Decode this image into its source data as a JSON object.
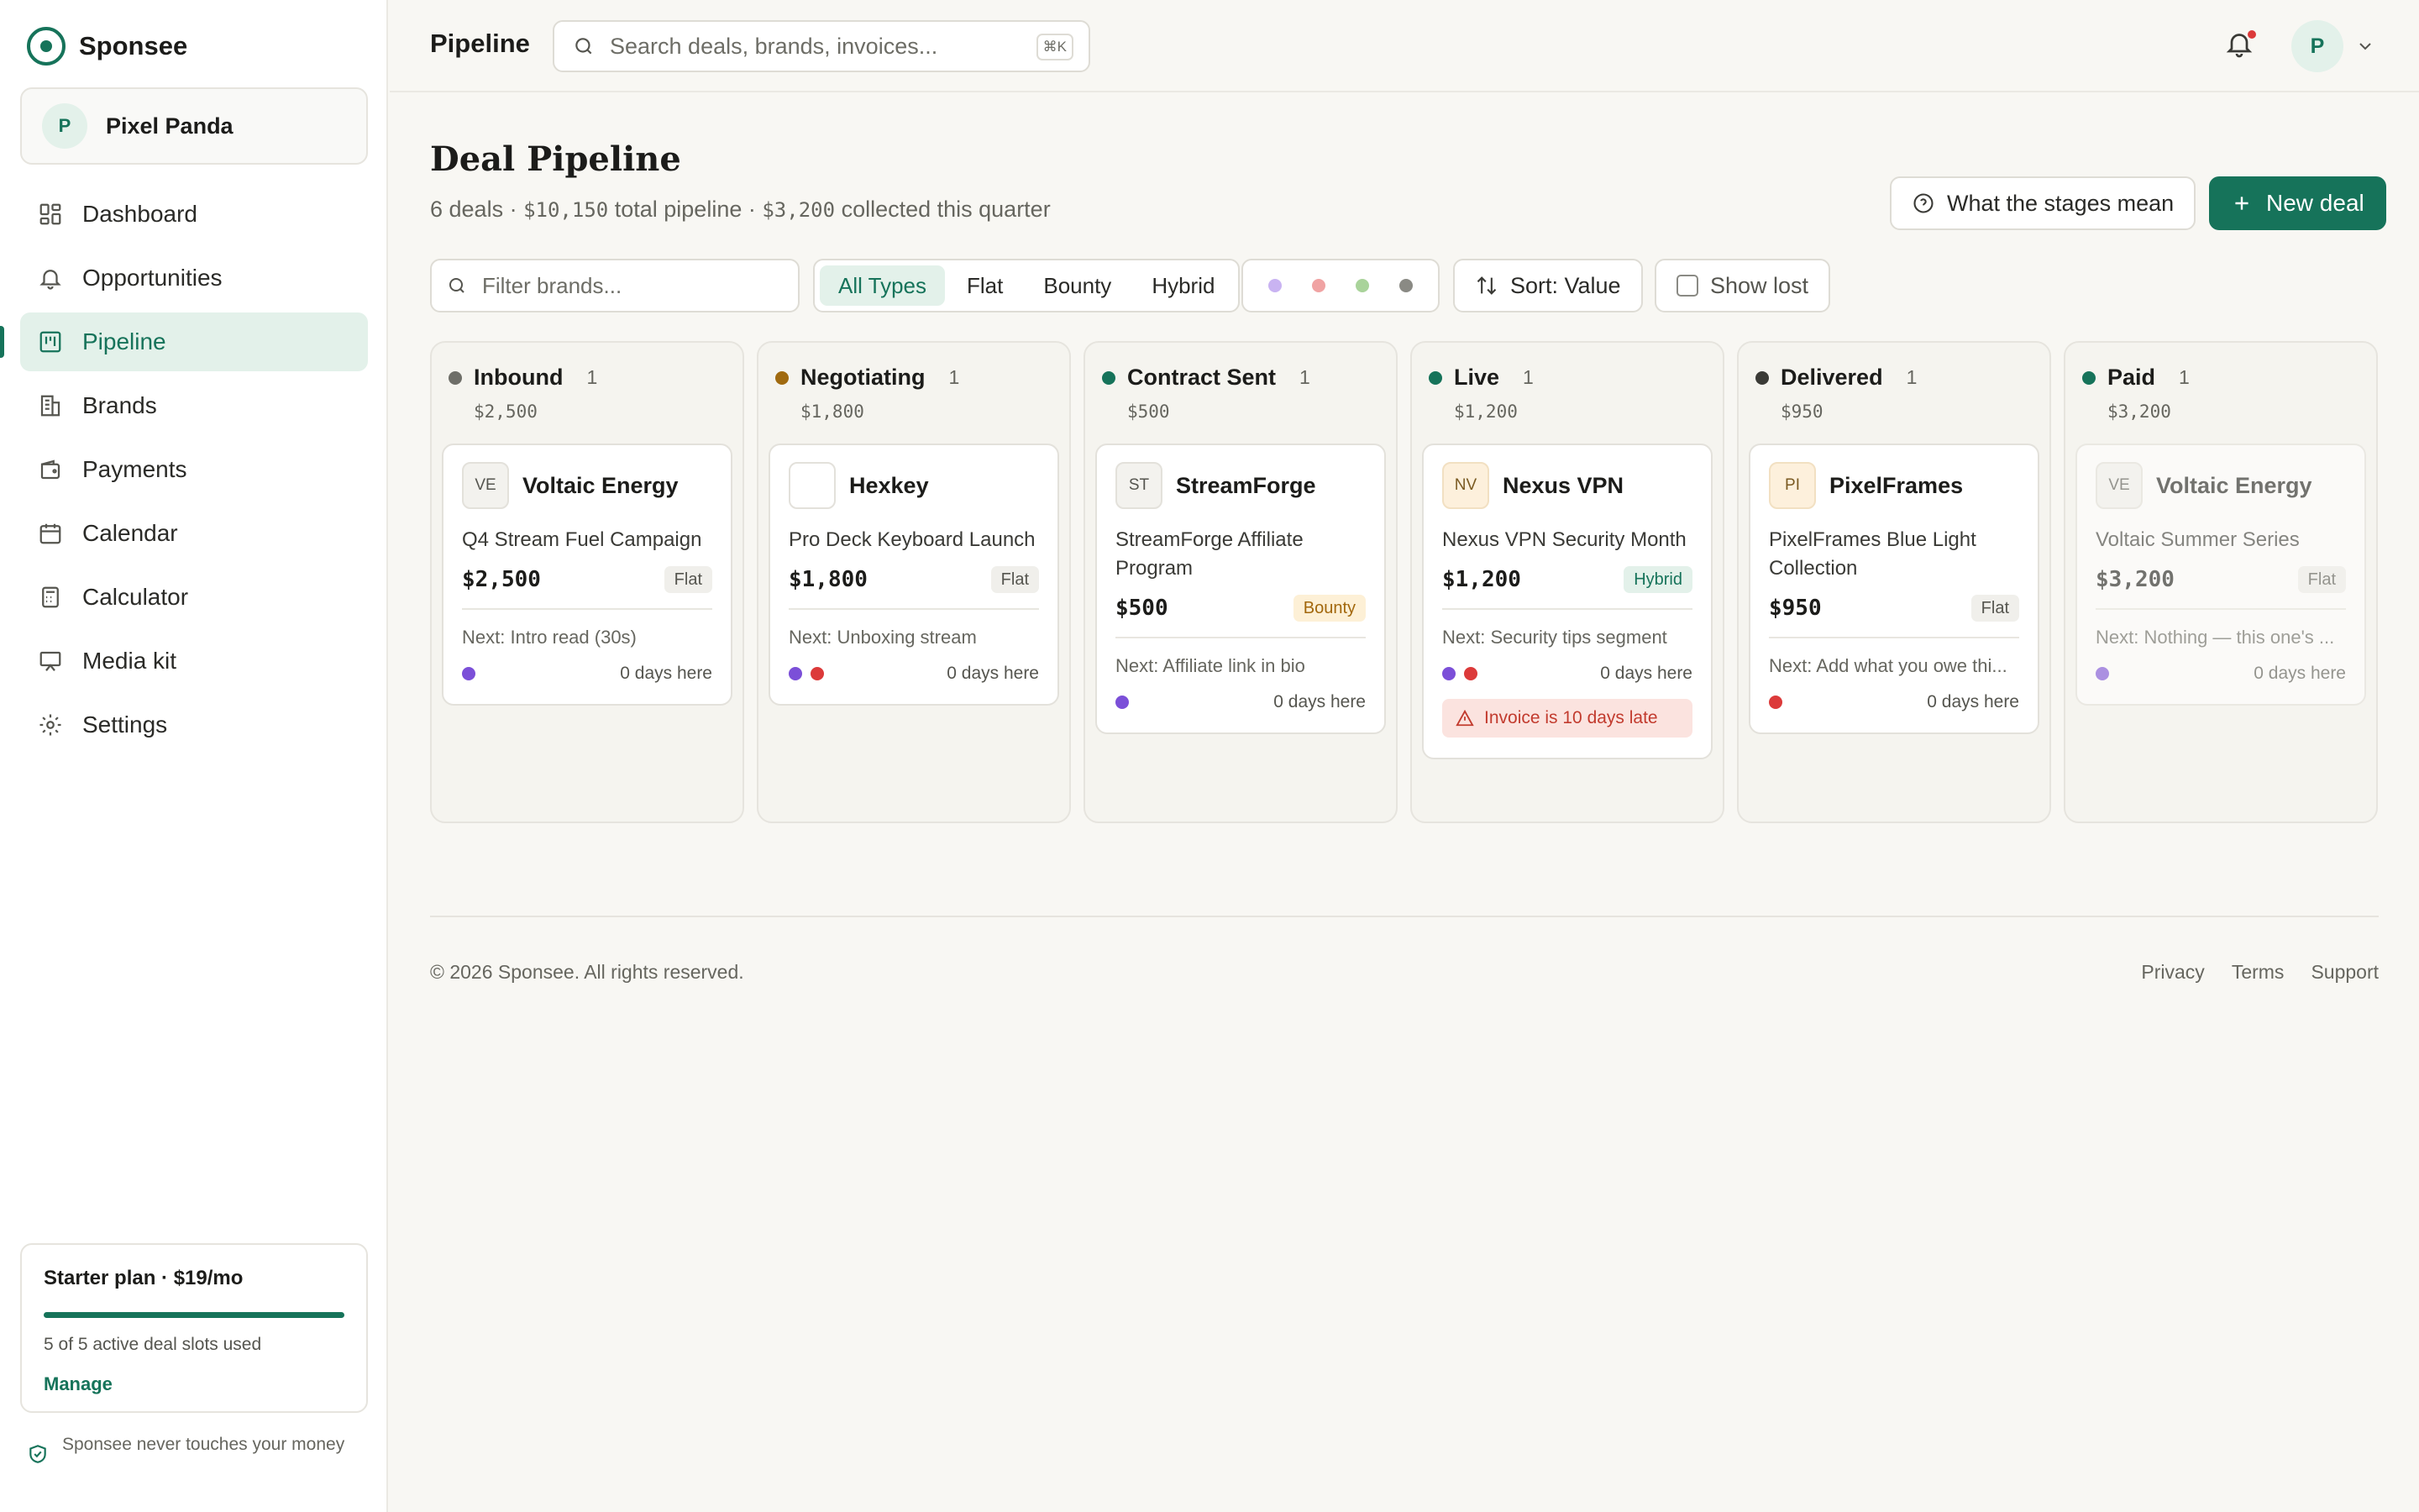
{
  "app": {
    "name": "Sponsee",
    "workspace": {
      "initial": "P",
      "name": "Pixel Panda"
    }
  },
  "sidebar": {
    "items": [
      {
        "label": "Dashboard",
        "icon": "dashboard-icon"
      },
      {
        "label": "Opportunities",
        "icon": "bell-icon"
      },
      {
        "label": "Pipeline",
        "icon": "pipeline-icon",
        "active": true
      },
      {
        "label": "Brands",
        "icon": "building-icon"
      },
      {
        "label": "Payments",
        "icon": "wallet-icon"
      },
      {
        "label": "Calendar",
        "icon": "calendar-icon"
      },
      {
        "label": "Calculator",
        "icon": "calculator-icon"
      },
      {
        "label": "Media kit",
        "icon": "presentation-icon"
      },
      {
        "label": "Settings",
        "icon": "gear-icon"
      }
    ],
    "plan": {
      "title": "Starter plan · $19/mo",
      "usage": "5 of 5 active deal slots used",
      "usage_fraction": 1.0,
      "manage": "Manage"
    },
    "trust_note": "Sponsee never touches your money"
  },
  "header": {
    "title": "Pipeline",
    "search_placeholder": "Search deals, brands, invoices...",
    "search_shortcut": "⌘K",
    "user_initial": "P"
  },
  "page": {
    "title": "Deal Pipeline",
    "summary": {
      "deals": "6 deals",
      "sep": " · ",
      "total_value": "$10,150",
      "total_label": " total pipeline",
      "collected_value": "$3,200",
      "collected_label": " collected this quarter"
    },
    "stages_button": "What the stages mean",
    "new_deal_button": "New deal"
  },
  "filters": {
    "brand_placeholder": "Filter brands...",
    "types": [
      "All Types",
      "Flat",
      "Bounty",
      "Hybrid"
    ],
    "active_type": "All Types",
    "color_dots": [
      "#c9b3f2",
      "#f0a3a3",
      "#a9d39a",
      "#8a8a84"
    ],
    "sort_label": "Sort: Value",
    "show_lost_label": "Show lost"
  },
  "columns": [
    {
      "name": "Inbound",
      "count": "1",
      "total": "$2,500",
      "color": "#6e6e68",
      "card": {
        "logo": "VE",
        "brand": "Voltaic Energy",
        "title": "Q4 Stream Fuel Campaign",
        "value": "$2,500",
        "type": "Flat",
        "next_label": "Next:",
        "next": "Intro read (30s)",
        "dots": [
          "#7b4fd8"
        ],
        "days": "0 days here"
      }
    },
    {
      "name": "Negotiating",
      "count": "1",
      "total": "$1,800",
      "color": "#a06a10",
      "card": {
        "logo": "",
        "brand": "Hexkey",
        "title": "Pro Deck Keyboard Launch",
        "value": "$1,800",
        "type": "Flat",
        "next_label": "Next:",
        "next": "Unboxing stream",
        "dots": [
          "#7b4fd8",
          "#dc3a3a"
        ],
        "days": "0 days here"
      }
    },
    {
      "name": "Contract Sent",
      "count": "1",
      "total": "$500",
      "color": "#16735a",
      "card": {
        "logo": "ST",
        "brand": "StreamForge",
        "title": "StreamForge Affiliate Program",
        "value": "$500",
        "type": "Bounty",
        "next_label": "Next:",
        "next": "Affiliate link in bio",
        "dots": [
          "#7b4fd8"
        ],
        "days": "0 days here"
      }
    },
    {
      "name": "Live",
      "count": "1",
      "total": "$1,200",
      "color": "#16735a",
      "card": {
        "logo": "NV",
        "brand": "Nexus VPN",
        "title": "Nexus VPN Security Month",
        "value": "$1,200",
        "type": "Hybrid",
        "next_label": "Next:",
        "next": "Security tips segment",
        "dots": [
          "#7b4fd8",
          "#dc3a3a"
        ],
        "days": "0 days here",
        "alert": "Invoice is 10 days late"
      }
    },
    {
      "name": "Delivered",
      "count": "1",
      "total": "$950",
      "color": "#3a3a36",
      "card": {
        "logo": "PI",
        "brand": "PixelFrames",
        "title": "PixelFrames Blue Light Collection",
        "value": "$950",
        "type": "Flat",
        "next_label": "Next:",
        "next": "Add what you owe thi...",
        "dots": [
          "#dc3a3a"
        ],
        "days": "0 days here"
      }
    },
    {
      "name": "Paid",
      "count": "1",
      "total": "$3,200",
      "color": "#16735a",
      "card": {
        "logo": "VE",
        "brand": "Voltaic Energy",
        "title": "Voltaic Summer Series",
        "value": "$3,200",
        "type": "Flat",
        "next_label": "Next:",
        "next": "Nothing — this one's ...",
        "dots": [
          "#7b4fd8"
        ],
        "days": "0 days here",
        "dim": true
      }
    }
  ],
  "footer": {
    "copyright": "© 2026 Sponsee. All rights reserved.",
    "links": [
      "Privacy",
      "Terms",
      "Support"
    ]
  }
}
